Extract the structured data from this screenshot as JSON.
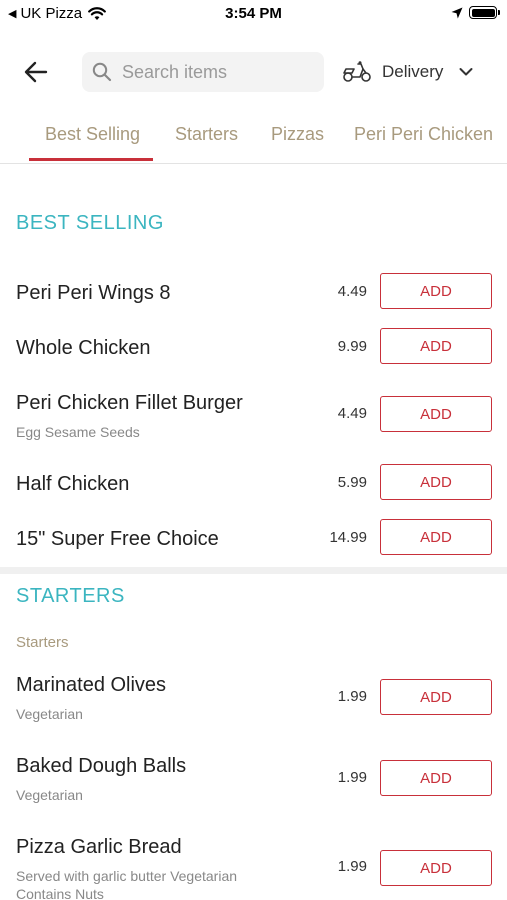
{
  "status_bar": {
    "carrier": "UK Pizza",
    "time": "3:54 PM"
  },
  "header": {
    "search_placeholder": "Search items",
    "delivery_label": "Delivery"
  },
  "tabs": [
    {
      "label": "Best Selling",
      "active": true
    },
    {
      "label": "Starters",
      "active": false
    },
    {
      "label": "Pizzas",
      "active": false
    },
    {
      "label": "Peri Peri Chicken",
      "active": false
    }
  ],
  "colors": {
    "accent_red": "#c8303a",
    "section_teal": "#3bb5c0",
    "tab_tan": "#a89a7e"
  },
  "sections": {
    "best_selling": {
      "title": "BEST SELLING",
      "items": [
        {
          "name": "Peri Peri Wings 8",
          "desc": "",
          "price": "4.49",
          "button": "ADD"
        },
        {
          "name": "Whole Chicken",
          "desc": "",
          "price": "9.99",
          "button": "ADD"
        },
        {
          "name": "Peri Chicken Fillet Burger",
          "desc": "Egg Sesame Seeds",
          "price": "4.49",
          "button": "ADD"
        },
        {
          "name": "Half Chicken",
          "desc": "",
          "price": "5.99",
          "button": "ADD"
        },
        {
          "name": "15\" Super Free Choice",
          "desc": "",
          "price": "14.99",
          "button": "ADD"
        }
      ]
    },
    "starters": {
      "title": "STARTERS",
      "subcategory": "Starters",
      "items": [
        {
          "name": "Marinated Olives",
          "desc": "Vegetarian",
          "price": "1.99",
          "button": "ADD"
        },
        {
          "name": "Baked Dough Balls",
          "desc": "Vegetarian",
          "price": "1.99",
          "button": "ADD"
        },
        {
          "name": "Pizza Garlic Bread",
          "desc": "Served with garlic butter Vegetarian Contains Nuts",
          "price": "1.99",
          "button": "ADD"
        }
      ]
    }
  }
}
